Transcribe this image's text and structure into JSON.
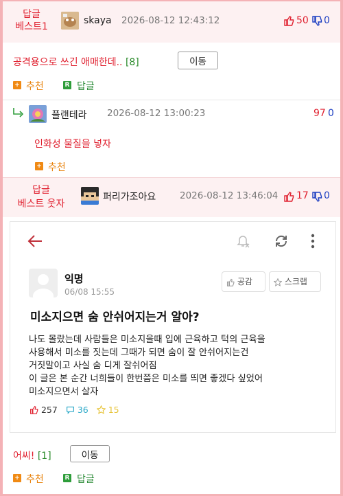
{
  "post1": {
    "best_label_line1": "답글",
    "best_label_line2": "베스트1",
    "nickname": "skaya",
    "datetime": "2026-08-12 12:43:12",
    "upvotes": "50",
    "downvotes": "0",
    "text": "공격용으로 쓰긴 애매한데..",
    "reply_count": "[8]",
    "move_label": "이동",
    "recommend_label": "추천",
    "reply_label": "답글"
  },
  "reply1": {
    "nickname": "플랜테라",
    "datetime": "2026-08-12 13:00:23",
    "upvotes": "97",
    "downvotes": "0",
    "text": "인화성 물질을 넣자",
    "recommend_label": "추천"
  },
  "post2": {
    "best_label_line1": "답글",
    "best_label_line2": "베스트 웃자",
    "nickname": "퍼리가조아요",
    "datetime": "2026-08-12 13:46:04",
    "upvotes": "17",
    "downvotes": "0",
    "text": "어씨!",
    "reply_count": "[1]",
    "move_label": "이동",
    "recommend_label": "추천",
    "reply_label": "답글"
  },
  "embed": {
    "author": "익명",
    "date": "06/08 15:55",
    "like_label": "공감",
    "scrap_label": "스크랩",
    "title": "미소지으면 숨 안쉬어지는거 알아?",
    "body_lines": [
      "나도 몰랐는데 사람들은 미소지을때 입에 근육하고 턱의 근육을",
      "사용해서 미소를 짓는데 그때가 되면 숨이 잘 안쉬어지는건",
      "거짓말이고 사실 숨 디게 잘쉬어짐",
      "이 글은 본 순간 너희들이 한번쯤은 미소를 띄면 좋겠다 싶었어",
      "미소지으면서 살자"
    ],
    "likes": "257",
    "comments": "36",
    "scraps": "15"
  },
  "colors": {
    "accent_red": "#e0202f",
    "down_blue": "#1d3fc2",
    "recommend_orange": "#f08a14",
    "reply_green": "#2e9d3a",
    "frame_pink": "#f4b2b6",
    "band_pink": "#fdf1f2"
  },
  "icons": [
    "thumbs-up-icon",
    "thumbs-down-icon",
    "reply-arrow-icon",
    "back-arrow-icon",
    "bell-off-icon",
    "refresh-icon",
    "more-vertical-icon",
    "star-icon",
    "comment-icon"
  ]
}
